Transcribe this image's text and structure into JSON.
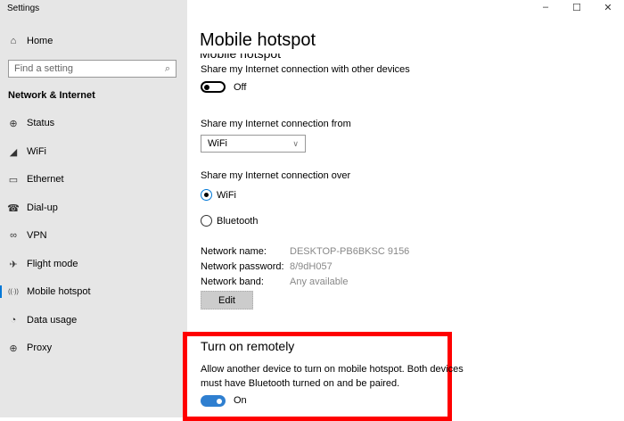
{
  "window": {
    "title": "Settings",
    "controls": {
      "minimize": "–",
      "maximize": "☐",
      "close": "✕"
    }
  },
  "sidebar": {
    "home": "Home",
    "search_placeholder": "Find a setting",
    "section": "Network & Internet",
    "items": [
      {
        "label": "Status",
        "icon": "⊕"
      },
      {
        "label": "WiFi",
        "icon": "◢"
      },
      {
        "label": "Ethernet",
        "icon": "▭"
      },
      {
        "label": "Dial-up",
        "icon": "☎"
      },
      {
        "label": "VPN",
        "icon": "∞"
      },
      {
        "label": "Flight mode",
        "icon": "✈"
      },
      {
        "label": "Mobile hotspot",
        "icon": "((·))"
      },
      {
        "label": "Data usage",
        "icon": "◔"
      },
      {
        "label": "Proxy",
        "icon": "⊕"
      }
    ],
    "selected": "Mobile hotspot"
  },
  "main": {
    "title": "Mobile hotspot",
    "subtitle": "Mobile hotspot",
    "share_label": "Share my Internet connection with other devices",
    "share_toggle": "Off",
    "from_label": "Share my Internet connection from",
    "from_value": "WiFi",
    "over_label": "Share my Internet connection over",
    "over_options": [
      "WiFi",
      "Bluetooth"
    ],
    "over_selected": "WiFi",
    "network": {
      "name_label": "Network name:",
      "name": "DESKTOP-PB6BKSC 9156",
      "password_label": "Network password:",
      "password": "8/9dH057",
      "band_label": "Network band:",
      "band": "Any available"
    },
    "edit": "Edit",
    "remote": {
      "title": "Turn on remotely",
      "desc1": "Allow another device to turn on mobile hotspot. Both devices",
      "desc2": "must have Bluetooth turned on and be paired.",
      "toggle": "On"
    }
  },
  "colors": {
    "accent": "#2f7fd0",
    "highlight": "#ff0000",
    "sidebar": "#e6e6e6"
  }
}
